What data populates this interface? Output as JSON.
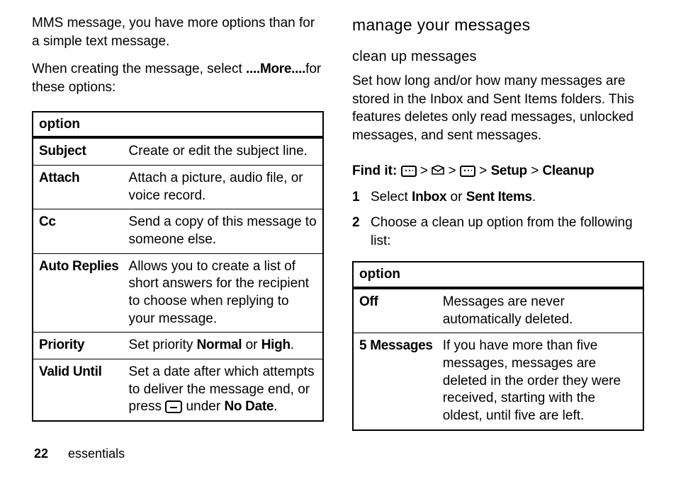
{
  "left": {
    "intro1": "MMS message, you have more options than for a simple text message.",
    "intro2a": "When creating the message, select ",
    "intro2b": "....More....",
    "intro2c": "for these options:",
    "table_header": "option",
    "rows": [
      {
        "label": "Subject",
        "desc": "Create or edit the subject line."
      },
      {
        "label": "Attach",
        "desc": "Attach a picture, audio file, or voice record."
      },
      {
        "label": "Cc",
        "desc": "Send a copy of this message to someone else."
      },
      {
        "label": "Auto Replies",
        "desc": "Allows you to create a list of short answers for the recipient to choose when replying to your message."
      },
      {
        "label": "Priority",
        "desc_a": "Set priority ",
        "desc_b": "Normal",
        "desc_c": " or ",
        "desc_d": "High",
        "desc_e": "."
      },
      {
        "label": "Valid Until",
        "desc_a": "Set a date after which attempts to deliver the message end, or press ",
        "desc_b": " under ",
        "desc_c": "No Date",
        "desc_d": "."
      }
    ]
  },
  "right": {
    "h2": "manage your messages",
    "h3": "clean up messages",
    "para": "Set how long and/or how many messages are stored in the Inbox and Sent Items folders. This features deletes only read messages, unlocked messages, and sent messages.",
    "findit_label": "Find it: ",
    "path": {
      "a": "Setup",
      "b": "Cleanup"
    },
    "steps": [
      {
        "n": "1",
        "a": "Select ",
        "b": "Inbox",
        "c": " or ",
        "d": "Sent Items",
        "e": "."
      },
      {
        "n": "2",
        "a": "Choose a clean up option from the following list:"
      }
    ],
    "table_header": "option",
    "rows": [
      {
        "label": "Off",
        "desc": "Messages are never automatically deleted."
      },
      {
        "label": "5 Messages",
        "desc": "If you have more than five messages, messages are deleted in the order they were received, starting with the oldest, until five are left."
      }
    ]
  },
  "footer": {
    "page": "22",
    "section": "essentials"
  }
}
